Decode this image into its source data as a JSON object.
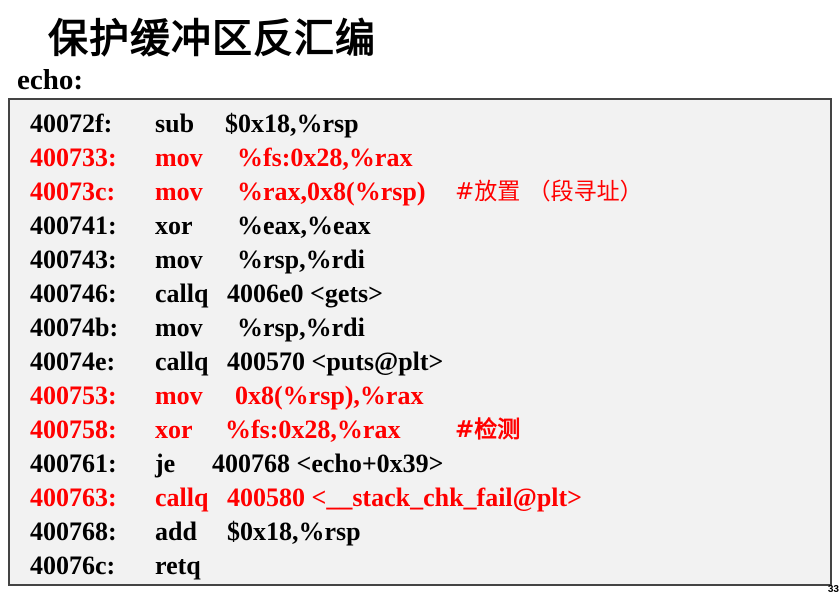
{
  "title": "保护缓冲区反汇编",
  "function_label": "echo:",
  "page_number": "33",
  "colors": {
    "highlight": "#ff0000",
    "normal": "#000000",
    "box_bg": "#f2f2f2"
  },
  "rows": [
    {
      "addr": "40072f:",
      "mnemonic": "sub",
      "operands": "$0x18,%rsp",
      "highlight": false,
      "comment": ""
    },
    {
      "addr": "400733:",
      "mnemonic": "mov",
      "operands": "%fs:0x28,%rax",
      "highlight": true,
      "comment": ""
    },
    {
      "addr": "40073c:",
      "mnemonic": "mov",
      "operands": "%rax,0x8(%rsp)",
      "highlight": true,
      "comment": "#放置 （段寻址）"
    },
    {
      "addr": "400741:",
      "mnemonic": "xor",
      "operands": "%eax,%eax",
      "highlight": false,
      "comment": ""
    },
    {
      "addr": "400743:",
      "mnemonic": "mov",
      "operands": "%rsp,%rdi",
      "highlight": false,
      "comment": ""
    },
    {
      "addr": "400746:",
      "mnemonic": "callq",
      "operands": "4006e0 <gets>",
      "highlight": false,
      "comment": ""
    },
    {
      "addr": "40074b:",
      "mnemonic": "mov",
      "operands": "%rsp,%rdi",
      "highlight": false,
      "comment": ""
    },
    {
      "addr": "40074e:",
      "mnemonic": "callq",
      "operands": "400570 <puts@plt>",
      "highlight": false,
      "comment": ""
    },
    {
      "addr": "400753:",
      "mnemonic": "mov",
      "operands": "0x8(%rsp),%rax",
      "highlight": true,
      "comment": ""
    },
    {
      "addr": "400758:",
      "mnemonic": "xor",
      "operands": "%fs:0x28,%rax",
      "highlight": true,
      "comment": "#检测"
    },
    {
      "addr": "400761:",
      "mnemonic": "je",
      "operands": "400768 <echo+0x39>",
      "highlight": false,
      "comment": ""
    },
    {
      "addr": "400763:",
      "mnemonic": "callq",
      "operands": "400580 <__stack_chk_fail@plt>",
      "highlight": true,
      "comment": ""
    },
    {
      "addr": "400768:",
      "mnemonic": "add",
      "operands": "$0x18,%rsp",
      "highlight": false,
      "comment": ""
    },
    {
      "addr": "40076c:",
      "mnemonic": "retq",
      "operands": "",
      "highlight": false,
      "comment": ""
    }
  ]
}
